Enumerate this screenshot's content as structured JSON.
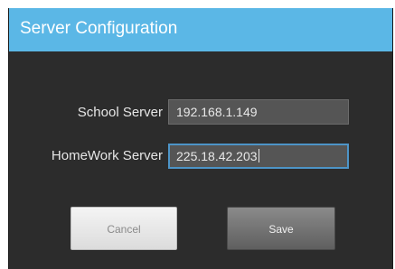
{
  "dialog": {
    "title": "Server Configuration",
    "fields": [
      {
        "label": "School Server",
        "value": "192.168.1.149"
      },
      {
        "label": "HomeWork Server",
        "value": "225.18.42.203"
      }
    ],
    "buttons": {
      "cancel_label": "Cancel",
      "save_label": "Save"
    }
  },
  "colors": {
    "header": "#5bb7e6",
    "body": "#2c2c2c",
    "field_bg": "#555555",
    "focus_border": "#4d94c7"
  }
}
